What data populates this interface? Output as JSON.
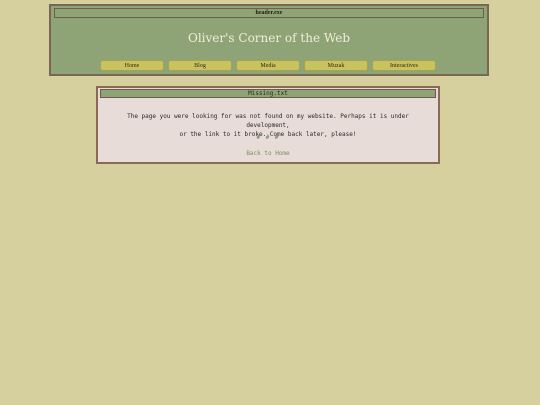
{
  "header": {
    "window_title": "header.exe",
    "site_title": "Oliver's Corner of the Web",
    "nav": [
      "Home",
      "Blog",
      "Media",
      "Muzak",
      "Interactives"
    ]
  },
  "missing": {
    "window_title": "Missing.txt",
    "message_line1": "The page you were looking for was not found on my website. Perhaps it is under development,",
    "message_line2": "or the link to it broke. Come back later, please!",
    "divider": "# # #",
    "back_link": "Back to Home"
  },
  "colors": {
    "page_background": "#d6d09e",
    "header_background": "#8ea476",
    "nav_button": "#c8c35f",
    "message_background": "#e8dcd8",
    "border_brown": "#7b6651",
    "link_green": "#7a8f63"
  }
}
